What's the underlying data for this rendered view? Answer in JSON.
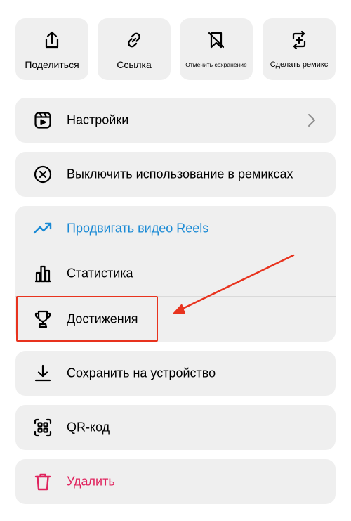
{
  "top_actions": [
    {
      "label": "Поделиться",
      "icon": "share-icon"
    },
    {
      "label": "Ссылка",
      "icon": "link-icon"
    },
    {
      "label": "Отменить сохранение",
      "icon": "unsave-bookmark-icon"
    },
    {
      "label": "Сделать ремикс",
      "icon": "remix-icon"
    }
  ],
  "menu": {
    "settings": {
      "label": "Настройки",
      "icon": "reels-icon"
    },
    "disable_remix": {
      "label": "Выключить использование в ремиксах",
      "icon": "close-circle-icon"
    },
    "promote": {
      "label": "Продвигать видео Reels",
      "icon": "trending-up-icon",
      "color": "#1a8ad5"
    },
    "stats": {
      "label": "Статистика",
      "icon": "bar-chart-icon"
    },
    "achievements": {
      "label": "Достижения",
      "icon": "trophy-icon"
    },
    "save_device": {
      "label": "Сохранить на устройство",
      "icon": "download-icon"
    },
    "qr": {
      "label": "QR-код",
      "icon": "qr-code-icon"
    },
    "delete": {
      "label": "Удалить",
      "icon": "trash-icon",
      "color": "#e0245e"
    }
  },
  "annotation": {
    "highlight_color": "#e8331e"
  }
}
